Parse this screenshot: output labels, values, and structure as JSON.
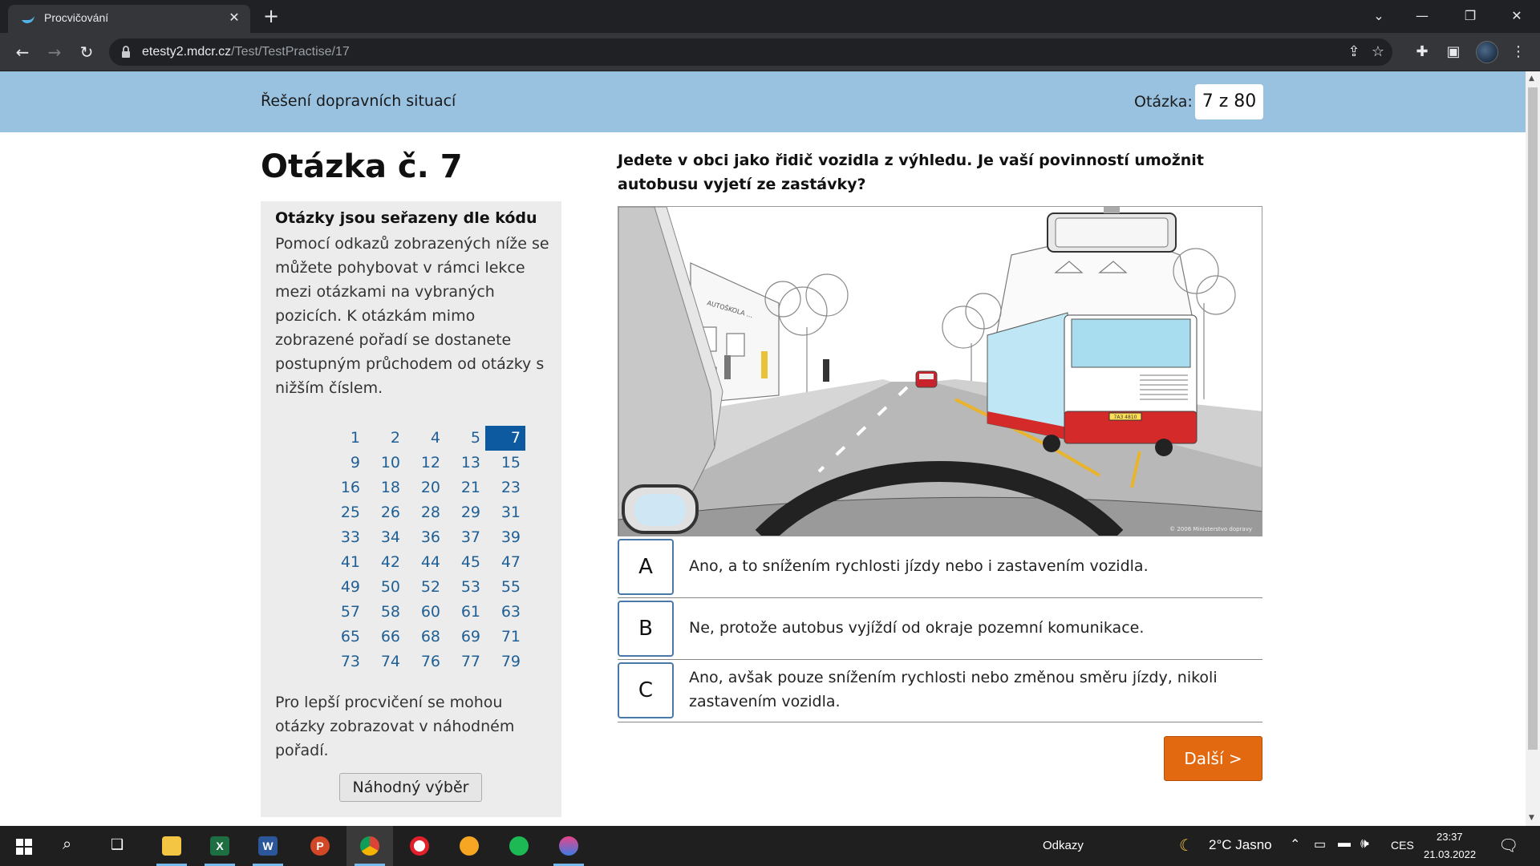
{
  "browser": {
    "tab_title": "Procvičování",
    "url_host": "etesty2.mdcr.cz",
    "url_path": "/Test/TestPractise/17"
  },
  "header": {
    "section": "Řešení dopravních situací",
    "counter_label": "Otázka:",
    "counter_value": "7 z 80"
  },
  "question": {
    "heading": "Otázka č. 7",
    "text": "Jedete v obci jako řidič vozidla z výhledu. Je vaší povinností umožnit autobusu vyjetí ze zastávky?"
  },
  "sidebar": {
    "title": "Otázky jsou seřazeny dle kódu",
    "text": "Pomocí odkazů zobrazených níže se můžete pohybovat v rámci lekce mezi otázkami na vybraných pozicích. K otázkám mimo zobrazené pořadí se dostanete postupným průchodem od otázky s nižším číslem.",
    "numbers": [
      "1",
      "2",
      "4",
      "5",
      "7",
      "9",
      "10",
      "12",
      "13",
      "15",
      "16",
      "18",
      "20",
      "21",
      "23",
      "25",
      "26",
      "28",
      "29",
      "31",
      "33",
      "34",
      "36",
      "37",
      "39",
      "41",
      "42",
      "44",
      "45",
      "47",
      "49",
      "50",
      "52",
      "53",
      "55",
      "57",
      "58",
      "60",
      "61",
      "63",
      "65",
      "66",
      "68",
      "69",
      "71",
      "73",
      "74",
      "76",
      "77",
      "79"
    ],
    "active": "7",
    "random_text": "Pro lepší procvičení se mohou otázky zobrazovat v náhodném pořadí.",
    "random_button": "Náhodný výběr"
  },
  "illustration": {
    "shop_sign": "AUTOŠKOLA ...",
    "plate": "7A3 4810",
    "copyright": "© 2006 Ministerstvo dopravy"
  },
  "answers": [
    {
      "key": "A",
      "text": "Ano, a to snížením rychlosti jízdy nebo i zastavením vozidla."
    },
    {
      "key": "B",
      "text": "Ne, protože autobus vyjíždí od okraje pozemní komunikace."
    },
    {
      "key": "C",
      "text": "Ano, avšak pouze snížením rychlosti nebo změnou směru jízdy, nikoli zastavením vozidla."
    }
  ],
  "next_button": "Další >",
  "taskbar": {
    "links_label": "Odkazy",
    "weather": "2°C  Jasno",
    "language": "CES",
    "time": "23:37",
    "date": "21.03.2022"
  },
  "colors": {
    "header_bg": "#99c2e1",
    "active_number": "#0d5aa0",
    "next_button": "#e2690f",
    "link": "#1f5f95"
  }
}
